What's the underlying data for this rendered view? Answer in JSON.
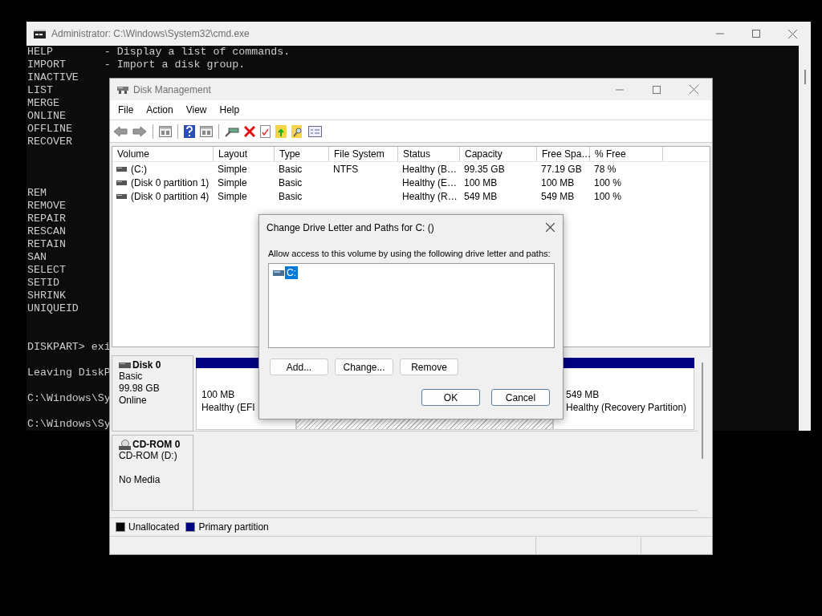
{
  "cmd_window": {
    "title": "Administrator: C:\\Windows\\System32\\cmd.exe",
    "lines": [
      {
        "kind": "text",
        "text": "HELP        - Display a list of commands."
      },
      {
        "kind": "text",
        "text": "IMPORT      - Import a disk group."
      },
      {
        "kind": "text",
        "text": "INACTIVE"
      },
      {
        "kind": "text",
        "text": "LIST"
      },
      {
        "kind": "text",
        "text": "MERGE"
      },
      {
        "kind": "text",
        "text": "ONLINE"
      },
      {
        "kind": "text",
        "text": "OFFLINE"
      },
      {
        "kind": "text",
        "text": "RECOVER"
      },
      {
        "kind": "blank"
      },
      {
        "kind": "blank"
      },
      {
        "kind": "blank"
      },
      {
        "kind": "text",
        "text": "REM"
      },
      {
        "kind": "text",
        "text": "REMOVE"
      },
      {
        "kind": "text",
        "text": "REPAIR"
      },
      {
        "kind": "text",
        "text": "RESCAN"
      },
      {
        "kind": "text",
        "text": "RETAIN"
      },
      {
        "kind": "text",
        "text": "SAN"
      },
      {
        "kind": "text",
        "text": "SELECT"
      },
      {
        "kind": "text",
        "text": "SETID"
      },
      {
        "kind": "text",
        "text": "SHRINK"
      },
      {
        "kind": "text",
        "text": "UNIQUEID"
      },
      {
        "kind": "blank"
      },
      {
        "kind": "blank"
      },
      {
        "kind": "text",
        "text": "DISKPART> exi"
      },
      {
        "kind": "blank"
      },
      {
        "kind": "text",
        "text": "Leaving DiskP"
      },
      {
        "kind": "blank"
      },
      {
        "kind": "text",
        "text": "C:\\Windows\\Sy"
      },
      {
        "kind": "blank"
      },
      {
        "kind": "text",
        "text": "C:\\Windows\\Sy"
      }
    ]
  },
  "disk_management": {
    "title": "Disk Management",
    "menu": [
      "File",
      "Action",
      "View",
      "Help"
    ],
    "columns": [
      "Volume",
      "Layout",
      "Type",
      "File System",
      "Status",
      "Capacity",
      "Free Spa…",
      "% Free"
    ],
    "rows": [
      {
        "cells": [
          "(C:)",
          "Simple",
          "Basic",
          "NTFS",
          "Healthy (B…",
          "99.35 GB",
          "77.19 GB",
          "78 %"
        ]
      },
      {
        "cells": [
          "(Disk 0 partition 1)",
          "Simple",
          "Basic",
          "",
          "Healthy (E…",
          "100 MB",
          "100 MB",
          "100 %"
        ]
      },
      {
        "cells": [
          "(Disk 0 partition 4)",
          "Simple",
          "Basic",
          "",
          "Healthy (R…",
          "549 MB",
          "549 MB",
          "100 %"
        ]
      }
    ],
    "disks": [
      {
        "kind": "disk",
        "name": "Disk 0",
        "lines": [
          "Basic",
          "99.98 GB",
          "Online"
        ],
        "partitions": [
          {
            "selected": false,
            "size": "100 MB",
            "status": "Healthy (EFI"
          },
          {
            "selected": true
          },
          {
            "selected": false,
            "size": "549 MB",
            "status": "Healthy (Recovery Partition)"
          }
        ]
      },
      {
        "kind": "cdrom",
        "name": "CD-ROM 0",
        "lines": [
          "CD-ROM (D:)"
        ],
        "note": "No Media"
      }
    ],
    "legend": [
      {
        "label": "Unallocated",
        "color": "#000000"
      },
      {
        "label": "Primary partition",
        "color": "#000080"
      }
    ]
  },
  "dialog": {
    "title": "Change Drive Letter and Paths for C: ()",
    "prompt": "Allow access to this volume by using the following drive letter and paths:",
    "entries": [
      {
        "label": "C:",
        "selected": true
      }
    ],
    "buttons": [
      "Add...",
      "Change...",
      "Remove"
    ],
    "footer_buttons": [
      "OK",
      "Cancel"
    ]
  }
}
